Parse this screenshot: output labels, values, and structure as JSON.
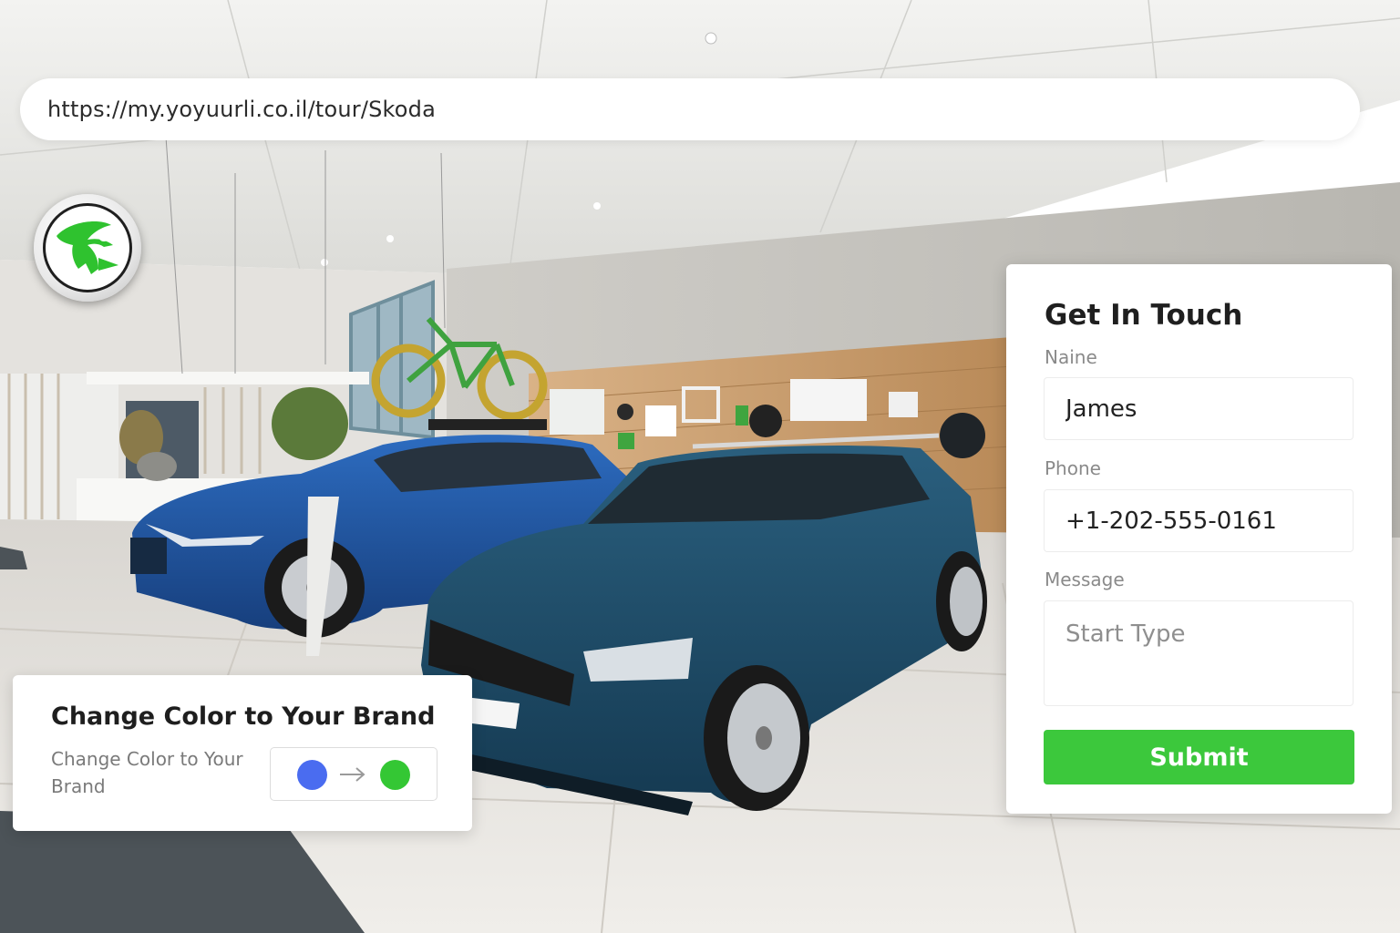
{
  "address_bar": {
    "url": "https://my.yoyuurli.co.il/tour/Skoda"
  },
  "logo": {
    "icon": "skoda-winged-arrow-icon",
    "color": "#2fc22f"
  },
  "brand_card": {
    "title": "Change Color to Your Brand",
    "description": "Change Color to Your Brand",
    "from_color": "#4a6cf0",
    "to_color": "#34c734",
    "arrow_icon": "arrow-right-icon"
  },
  "contact_form": {
    "title": "Get In Touch",
    "name_label": "Naine",
    "name_value": "James",
    "phone_label": "Phone",
    "phone_value": "+1-202-555-0161",
    "message_label": "Message",
    "message_placeholder": "Start Type",
    "submit_label": "Submit",
    "accent_color": "#3cc83c"
  }
}
